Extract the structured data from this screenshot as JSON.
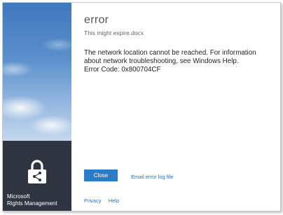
{
  "dialog": {
    "title": "error",
    "filename": "This might expire.docx",
    "message_lines": [
      "The network location cannot be reached. For information",
      "about network troubleshooting, see Windows Help.",
      "Error Code: 0x800704CF"
    ],
    "close_label": "Close",
    "email_log_label": "Email error log file",
    "privacy_label": "Privacy",
    "help_label": "Help"
  },
  "branding": {
    "line1": "Microsoft",
    "line2": "Rights Management",
    "icon": "lock-share-icon"
  },
  "colors": {
    "accent": "#2b7bc7",
    "link": "#2b6fb7",
    "brand_block": "#2f3441"
  }
}
